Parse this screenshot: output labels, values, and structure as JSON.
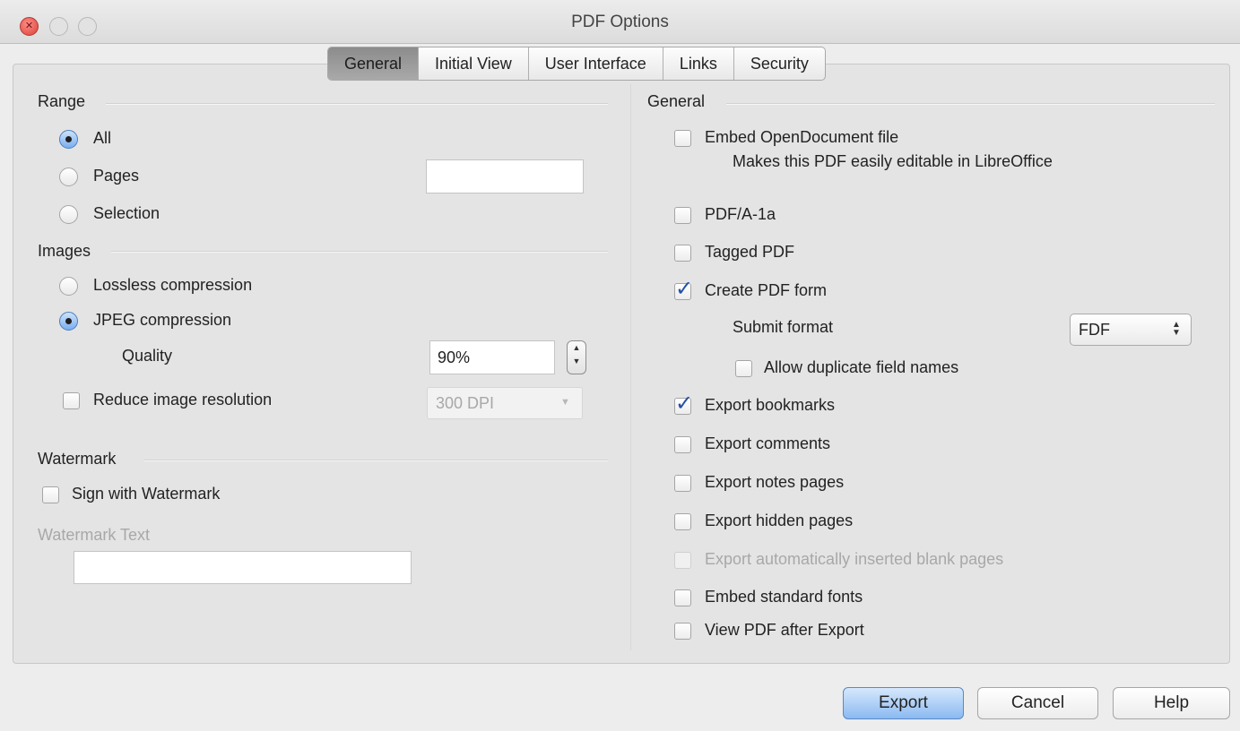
{
  "window": {
    "title": "PDF Options"
  },
  "tabs": [
    "General",
    "Initial View",
    "User Interface",
    "Links",
    "Security"
  ],
  "active_tab": "General",
  "left": {
    "range": {
      "title": "Range",
      "options": [
        "All",
        "Pages",
        "Selection"
      ],
      "selected": "All",
      "pages_value": ""
    },
    "images": {
      "title": "Images",
      "options": [
        "Lossless compression",
        "JPEG compression"
      ],
      "selected": "JPEG compression",
      "quality_label": "Quality",
      "quality_value": "90%",
      "reduce_label": "Reduce image resolution",
      "reduce_checked": false,
      "resolution_value": "300 DPI"
    },
    "watermark": {
      "title": "Watermark",
      "sign_label": "Sign with Watermark",
      "sign_checked": false,
      "text_label": "Watermark Text",
      "text_value": ""
    }
  },
  "right": {
    "title": "General",
    "embed_odf": {
      "label": "Embed OpenDocument file",
      "description": "Makes this PDF easily editable in LibreOffice",
      "checked": false
    },
    "pdfa": {
      "label": "PDF/A-1a",
      "checked": false
    },
    "tagged": {
      "label": "Tagged PDF",
      "checked": false
    },
    "create_form": {
      "label": "Create PDF form",
      "checked": true
    },
    "submit_format": {
      "label": "Submit format",
      "value": "FDF"
    },
    "allow_duplicate": {
      "label": "Allow duplicate field names",
      "checked": false
    },
    "export_bookmarks": {
      "label": "Export bookmarks",
      "checked": true
    },
    "export_comments": {
      "label": "Export comments",
      "checked": false
    },
    "export_notes": {
      "label": "Export notes pages",
      "checked": false
    },
    "export_hidden": {
      "label": "Export hidden pages",
      "checked": false
    },
    "export_blank": {
      "label": "Export automatically inserted blank pages",
      "checked": false,
      "enabled": false
    },
    "embed_fonts": {
      "label": "Embed standard fonts",
      "checked": false
    },
    "view_after": {
      "label": "View PDF after Export",
      "checked": false
    }
  },
  "buttons": {
    "export": "Export",
    "cancel": "Cancel",
    "help": "Help"
  }
}
